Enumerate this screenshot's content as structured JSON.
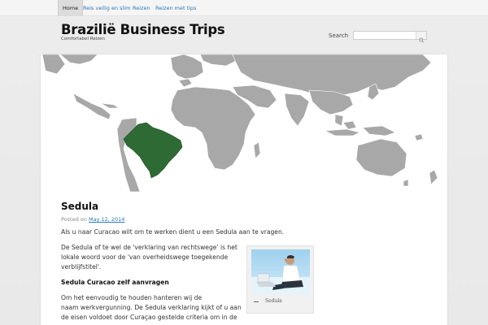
{
  "nav": {
    "items": [
      {
        "label": "Home",
        "active": true
      },
      {
        "label": "Reis veilig en slim",
        "active": false
      },
      {
        "label": "Reizen",
        "active": false
      },
      {
        "label": "Reizen met tips",
        "active": false
      }
    ]
  },
  "header": {
    "title": "Braziliё Business Trips",
    "tagline": "Comfortabel Reizen",
    "search_label": "Search",
    "search_value": ""
  },
  "post": {
    "title": "Sedula",
    "posted_on": "Posted on",
    "date": "May 12, 2014",
    "p1": "Als u naar Curacao wilt om te werken dient u een Sedula aan te vragen.",
    "p2_line1": "De Sedula of te wel de 'verklaring van rechtswege' is het",
    "p2_line2": "lokale woord voor de 'van overheidswege toegekende",
    "p2_line3": "verblijfstitel'.",
    "subheading": "Sedula Curacao zelf aanvragen",
    "p3_line1": "Om het eenvoudig te houden hanteren wij de",
    "p3_line2": "naam werkvergunning. De Sedula verklaring kijkt of u aan",
    "p3_line3": "de eisen voldoet door Curaçao gestelde criteria om in de",
    "figure_caption": "Sedula"
  },
  "colors": {
    "link": "#2a78b8",
    "map_land": "#a8a8a8",
    "map_highlight": "#2e6b34"
  }
}
